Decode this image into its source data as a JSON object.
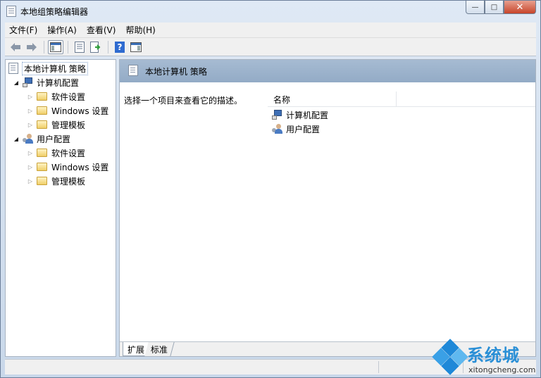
{
  "window": {
    "title": "本地组策略编辑器",
    "buttons": {
      "minimize": "—",
      "maximize": "□",
      "close": "✕"
    }
  },
  "menu": [
    "文件(F)",
    "操作(A)",
    "查看(V)",
    "帮助(H)"
  ],
  "toolbar": {
    "icons": [
      "back-arrow-icon",
      "forward-arrow-icon",
      "show-hide-tree-icon",
      "properties-icon",
      "export-list-icon",
      "help-icon",
      "show-action-pane-icon"
    ]
  },
  "tree": {
    "root": "本地计算机 策略",
    "computer_config": "计算机配置",
    "computer_children": [
      "软件设置",
      "Windows 设置",
      "管理模板"
    ],
    "user_config": "用户配置",
    "user_children": [
      "软件设置",
      "Windows 设置",
      "管理模板"
    ]
  },
  "main": {
    "header_title": "本地计算机 策略",
    "description": "选择一个项目来查看它的描述。",
    "column_name": "名称",
    "items": [
      "计算机配置",
      "用户配置"
    ]
  },
  "tabs": [
    "扩展",
    "标准"
  ],
  "watermark": {
    "text": "系统城",
    "url": "xitongcheng.com"
  }
}
